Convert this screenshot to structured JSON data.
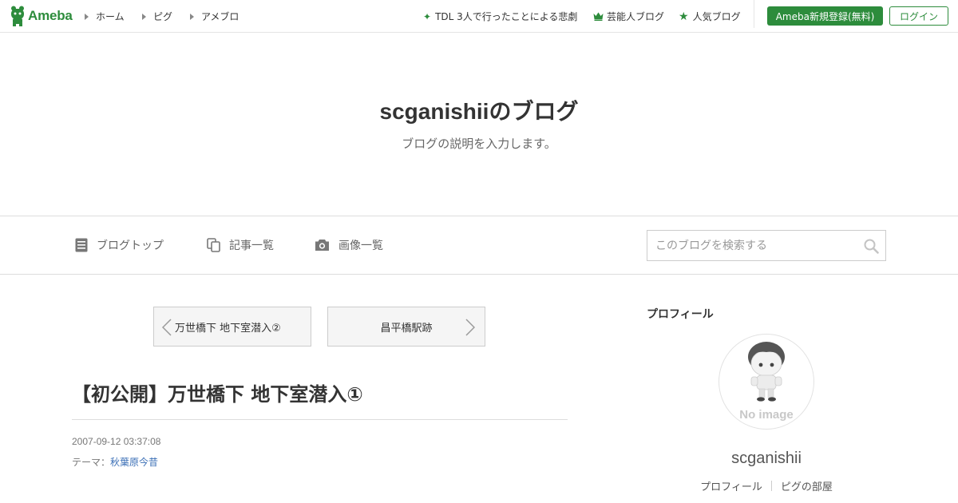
{
  "topbar": {
    "logo_text": "Ameba",
    "nav": [
      "ホーム",
      "ピグ",
      "アメブロ"
    ],
    "trend_link": "TDL 3人で行ったことによる悲劇",
    "celebrity_blog": "芸能人ブログ",
    "popular_blog": "人気ブログ",
    "register_button": "Ameba新規登録(無料)",
    "login_button": "ログイン"
  },
  "header": {
    "blog_title": "scganishiiのブログ",
    "blog_description": "ブログの説明を入力します。"
  },
  "blog_nav": {
    "items": [
      "ブログトップ",
      "記事一覧",
      "画像一覧"
    ],
    "search_placeholder": "このブログを検索する"
  },
  "pager": {
    "prev_title": "万世橋下 地下室潜入②",
    "next_title": "昌平橋駅跡"
  },
  "article": {
    "title": "【初公開】万世橋下 地下室潜入①",
    "date": "2007-09-12 03:37:08",
    "theme_label": "テーマ：",
    "theme_value": "秋葉原今昔"
  },
  "sidebar": {
    "heading": "プロフィール",
    "avatar_text": "No image",
    "name": "scganishii",
    "links": [
      "プロフィール",
      "ピグの部屋"
    ]
  },
  "colors": {
    "brand_green": "#2d8c3c",
    "link_blue": "#3b6fb6"
  }
}
